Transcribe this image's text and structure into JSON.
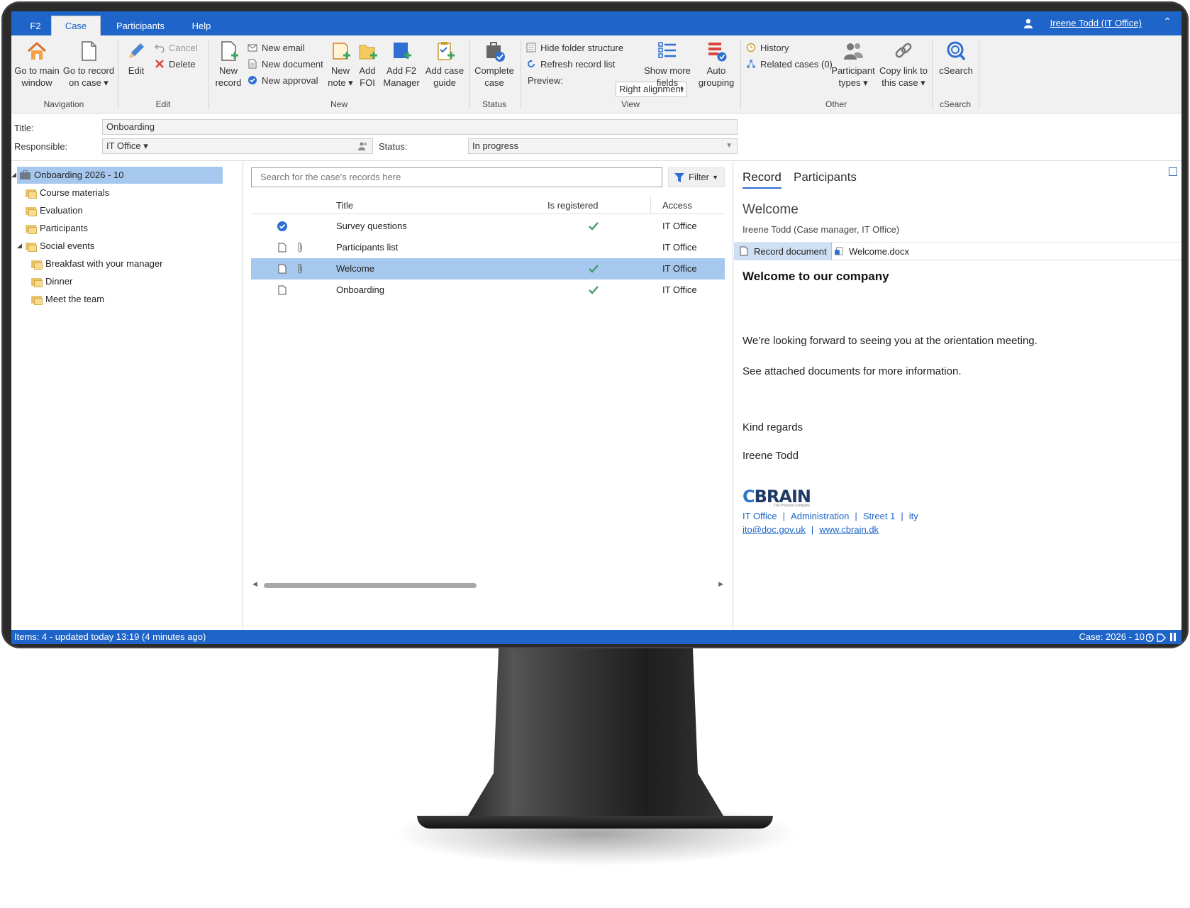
{
  "tabs": {
    "f2": "F2",
    "case": "Case",
    "participants": "Participants",
    "help": "Help"
  },
  "user": {
    "name": "Ireene Todd (IT Office)"
  },
  "ribbon": {
    "navigation": {
      "go_main_1": "Go to main",
      "go_main_2": "window",
      "go_record_1": "Go to record",
      "go_record_2": "on case ▾",
      "label": "Navigation"
    },
    "edit": {
      "edit": "Edit",
      "cancel": "Cancel",
      "delete": "Delete",
      "label": "Edit"
    },
    "new": {
      "new_record_1": "New",
      "new_record_2": "record",
      "new_email": "New email",
      "new_document": "New document",
      "new_approval": "New approval",
      "new_note_1": "New",
      "new_note_2": "note ▾",
      "add_foi_1": "Add",
      "add_foi_2": "FOI",
      "add_manager_1": "Add F2",
      "add_manager_2": "Manager",
      "add_guide_1": "Add case",
      "add_guide_2": "guide",
      "label": "New"
    },
    "status": {
      "complete_1": "Complete",
      "complete_2": "case",
      "label": "Status"
    },
    "view": {
      "hide_folder": "Hide folder structure",
      "refresh_list": "Refresh record list",
      "preview_label": "Preview:",
      "preview_value": "Right alignment",
      "show_more_1": "Show more",
      "show_more_2": "fields",
      "auto_group_1": "Auto",
      "auto_group_2": "grouping",
      "label": "View"
    },
    "other": {
      "history": "History",
      "related_cases": "Related cases (0)",
      "participant_types_1": "Participant",
      "participant_types_2": "types ▾",
      "copy_link_1": "Copy link to",
      "copy_link_2": "this case ▾",
      "label": "Other"
    },
    "csearch": {
      "button": "cSearch",
      "label": "cSearch"
    }
  },
  "case_fields": {
    "title_label": "Title:",
    "title_value": "Onboarding",
    "responsible_label": "Responsible:",
    "responsible_value": "IT Office ▾",
    "status_label": "Status:",
    "status_value": "In progress"
  },
  "tree": {
    "root": "Onboarding 2026 - 10",
    "items": [
      "Course materials",
      "Evaluation",
      "Participants",
      "Social events",
      "Breakfast with your manager",
      "Dinner",
      "Meet the team"
    ]
  },
  "records": {
    "search_placeholder": "Search for the case's records here",
    "filter": "Filter",
    "columns": {
      "title": "Title",
      "registered": "Is registered",
      "access": "Access"
    },
    "rows": [
      {
        "title": "Survey questions",
        "registered": true,
        "access": "IT Office",
        "type": "approval",
        "attachment": false
      },
      {
        "title": "Participants list",
        "registered": false,
        "access": "IT Office",
        "type": "document",
        "attachment": true
      },
      {
        "title": "Welcome",
        "registered": true,
        "access": "IT Office",
        "type": "document",
        "attachment": true,
        "selected": true
      },
      {
        "title": "Onboarding",
        "registered": true,
        "access": "IT Office",
        "type": "document",
        "attachment": false
      }
    ]
  },
  "preview": {
    "tab_record": "Record",
    "tab_participants": "Participants",
    "record_title": "Welcome",
    "record_sub": "Ireene Todd (Case manager, IT Office)",
    "doc_tab_record": "Record document",
    "doc_tab_file": "Welcome.docx",
    "doc": {
      "heading": "Welcome to our company",
      "p1": "We’re looking forward to seeing you at the orientation meeting.",
      "p2": "See attached documents for more information.",
      "p3": "Kind regards",
      "p4": "Ireene Todd",
      "logo": "BRAIN",
      "logo_c": "C",
      "logo_tag": "The Process Company",
      "sig_office": "IT Office",
      "sig_admin": "Administration",
      "sig_street": "Street 1",
      "sig_city": "ity",
      "sig_email": "ito@doc.gov.uk",
      "sig_web": "www.cbrain.dk"
    }
  },
  "statusbar": {
    "left": "Items: 4 - updated today 13:19 (4 minutes ago)",
    "right": "Case: 2026 - 10"
  },
  "colors": {
    "accent": "#1f64c8",
    "selection": "#a6c8ee",
    "check": "#3f9c6b"
  }
}
